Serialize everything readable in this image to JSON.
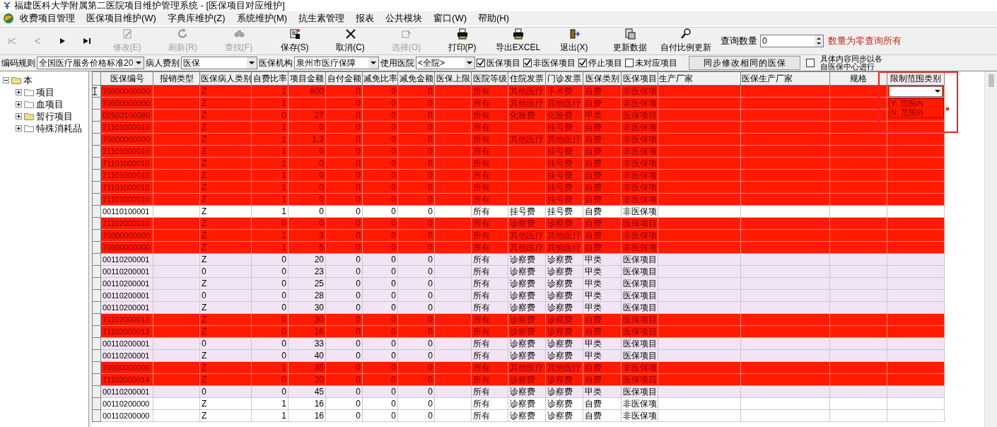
{
  "window": {
    "title": "福建医科大学附属第二医院项目维护管理系统 - [医保项目对应维护]"
  },
  "menu": [
    "收费项目管理",
    "医保项目维护(W)",
    "字典库维护(Z)",
    "系统维护(M)",
    "抗生素管理",
    "报表",
    "公共模块",
    "窗口(W)",
    "帮助(H)"
  ],
  "toolbar": {
    "buttons": [
      {
        "kind": "first",
        "disabled": true
      },
      {
        "kind": "prev",
        "disabled": true
      },
      {
        "kind": "next",
        "disabled": false
      },
      {
        "kind": "last",
        "disabled": false
      },
      {
        "kind": "edit",
        "label": "修改(E)",
        "disabled": true
      },
      {
        "kind": "refresh",
        "label": "刷新(R)",
        "disabled": true
      },
      {
        "kind": "find",
        "label": "查找(F)",
        "disabled": true
      },
      {
        "kind": "save",
        "label": "保存(S)",
        "disabled": false
      },
      {
        "kind": "cancel",
        "label": "取消(C)",
        "disabled": false
      },
      {
        "kind": "select",
        "label": "选择(O)",
        "disabled": true
      },
      {
        "kind": "print",
        "label": "打印(P)",
        "disabled": false
      },
      {
        "kind": "export",
        "label": "导出EXCEL",
        "disabled": false
      },
      {
        "kind": "exit",
        "label": "退出(X)",
        "disabled": false
      },
      {
        "kind": "update",
        "label": "更新数据",
        "disabled": false
      },
      {
        "kind": "ratio",
        "label": "自付比例更新",
        "disabled": false
      }
    ],
    "query_label": "查询数量",
    "query_value": "0",
    "query_hint": "数量为零查询所有"
  },
  "filters": {
    "selects": [
      {
        "label": "编码规则",
        "value": "全国医疗服务价格标准20"
      },
      {
        "label": "病人费别",
        "value": "医保"
      },
      {
        "label": "医保机构",
        "value": "泉州市医疗保障"
      },
      {
        "label": "使用医院",
        "value": "<全院>"
      }
    ],
    "checkboxes": [
      {
        "label": "医保项目",
        "checked": true
      },
      {
        "label": "非医保项目",
        "checked": true
      },
      {
        "label": "停止项目",
        "checked": true
      },
      {
        "label": "未对应项目",
        "checked": false
      }
    ],
    "sync_button": "同步修改相同的医保",
    "sync_checkbox": {
      "checked": false
    },
    "sync_note": [
      "具体内容同步以各",
      "自医保中心进行"
    ]
  },
  "tree": {
    "label": "本",
    "expanded": true,
    "children": [
      {
        "label": "项目",
        "expanded": false,
        "kind": "plain"
      },
      {
        "label": "血项目",
        "expanded": false,
        "kind": "plain"
      },
      {
        "label": "暂行项目",
        "expanded": false,
        "kind": "filled"
      },
      {
        "label": "特殊消耗品",
        "expanded": false,
        "kind": "plain"
      }
    ]
  },
  "table": {
    "columns": [
      "医保编号",
      "报销类型",
      "医保病人类别",
      "自费比率",
      "项目金额",
      "自付金额",
      "减免比率",
      "减免金额",
      "医保上限",
      "医院等级",
      "住院发票",
      "门诊发票",
      "医保类别",
      "医保项目",
      "生产厂家",
      "医保生产厂家",
      "规格",
      "限制范围类别"
    ],
    "dropdown": {
      "options": [
        "Y: 范围内",
        "N: 范围外"
      ]
    },
    "rows": [
      {
        "color": "#ff1a00",
        "current": true,
        "cells": [
          "70000000000",
          "",
          "Z",
          "1",
          "800",
          "0",
          "0",
          "0",
          "",
          "所有",
          "其他医疗",
          "手术费",
          "自费",
          "非医保项",
          "",
          "",
          "",
          ""
        ]
      },
      {
        "color": "#ff1a00",
        "current": false,
        "cells": [
          "70000000000",
          "",
          "Z",
          "1",
          "",
          "0",
          "0",
          "0",
          "",
          "所有",
          "其他医疗",
          "其他医疗",
          "自费",
          "非医保项",
          "",
          "",
          "",
          ""
        ]
      },
      {
        "color": "#ff1a00",
        "current": false,
        "cells": [
          "02503100080",
          "",
          "Z",
          "0",
          "27",
          "0",
          "0",
          "0",
          "",
          "所有",
          "化验费",
          "化验费",
          "甲类",
          "医保项目",
          "",
          "",
          "",
          ""
        ]
      },
      {
        "color": "#ff1a00",
        "current": false,
        "cells": [
          "71101000010",
          "",
          "Z",
          "1",
          "0",
          "0",
          "0",
          "0",
          "",
          "所有",
          "",
          "挂号费",
          "自费",
          "非医保项",
          "",
          "",
          "",
          ""
        ]
      },
      {
        "color": "#ff1a00",
        "current": false,
        "cells": [
          "70000000000",
          "",
          "Z",
          "1",
          "1.3",
          "0",
          "0",
          "0",
          "",
          "所有",
          "其他医疗",
          "其他医疗",
          "自费",
          "非医保项",
          "",
          "",
          "",
          ""
        ]
      },
      {
        "color": "#ff1a00",
        "current": false,
        "cells": [
          "71101000010",
          "",
          "Z",
          "1",
          "0",
          "0",
          "0",
          "0",
          "",
          "所有",
          "",
          "挂号费",
          "自费",
          "非医保项",
          "",
          "",
          "",
          ""
        ]
      },
      {
        "color": "#ff1a00",
        "current": false,
        "cells": [
          "71101000010",
          "",
          "Z",
          "1",
          "0",
          "0",
          "0",
          "0",
          "",
          "所有",
          "",
          "挂号费",
          "自费",
          "非医保项",
          "",
          "",
          "",
          ""
        ]
      },
      {
        "color": "#ff1a00",
        "current": false,
        "cells": [
          "71101000010",
          "",
          "Z",
          "1",
          "0",
          "0",
          "0",
          "0",
          "",
          "所有",
          "",
          "挂号费",
          "自费",
          "非医保项",
          "",
          "",
          "",
          ""
        ]
      },
      {
        "color": "#ff1a00",
        "current": false,
        "cells": [
          "71101000010",
          "",
          "Z",
          "1",
          "0",
          "0",
          "0",
          "0",
          "",
          "所有",
          "",
          "挂号费",
          "自费",
          "非医保项",
          "",
          "",
          "",
          ""
        ]
      },
      {
        "color": "#ff1a00",
        "current": false,
        "cells": [
          "71101000010",
          "",
          "Z",
          "1",
          "0",
          "0",
          "0",
          "0",
          "",
          "所有",
          "",
          "挂号费",
          "自费",
          "非医保项",
          "",
          "",
          "",
          ""
        ]
      },
      {
        "color": "#ffffff",
        "current": false,
        "cells": [
          "00110100001",
          "",
          "Z",
          "1",
          "0",
          "0",
          "0",
          "0",
          "",
          "所有",
          "挂号费",
          "挂号费",
          "自费",
          "非医保项",
          "",
          "",
          "",
          ""
        ]
      },
      {
        "color": "#ff1a00",
        "current": false,
        "cells": [
          "71102000010",
          "",
          "Z",
          "0",
          "0",
          "0",
          "0",
          "0",
          "",
          "所有",
          "诊察费",
          "诊察费",
          "自费",
          "医保项目",
          "",
          "",
          "",
          ""
        ]
      },
      {
        "color": "#ff1a00",
        "current": false,
        "cells": [
          "70000000000",
          "",
          "Z",
          "1",
          "3",
          "0",
          "0",
          "0",
          "",
          "所有",
          "其他医疗",
          "其他医疗",
          "自费",
          "非医保项",
          "",
          "",
          "",
          ""
        ]
      },
      {
        "color": "#ff1a00",
        "current": false,
        "cells": [
          "70000000000",
          "",
          "Z",
          "1",
          "5",
          "0",
          "0",
          "0",
          "",
          "所有",
          "其他医疗",
          "其他医疗",
          "自费",
          "非医保项",
          "",
          "",
          "",
          ""
        ]
      },
      {
        "color": "#f1e5f5",
        "current": false,
        "cells": [
          "00110200001",
          "",
          "Z",
          "0",
          "20",
          "0",
          "0",
          "0",
          "",
          "所有",
          "诊察费",
          "诊察费",
          "甲类",
          "医保项目",
          "",
          "",
          "",
          ""
        ]
      },
      {
        "color": "#f1e5f5",
        "current": false,
        "cells": [
          "00110200001",
          "",
          "0",
          "0",
          "23",
          "0",
          "0",
          "0",
          "",
          "所有",
          "诊察费",
          "诊察费",
          "甲类",
          "医保项目",
          "",
          "",
          "",
          ""
        ]
      },
      {
        "color": "#f1e5f5",
        "current": false,
        "cells": [
          "00110200001",
          "",
          "Z",
          "0",
          "25",
          "0",
          "0",
          "0",
          "",
          "所有",
          "诊察费",
          "诊察费",
          "甲类",
          "医保项目",
          "",
          "",
          "",
          ""
        ]
      },
      {
        "color": "#f1e5f5",
        "current": false,
        "cells": [
          "00110200001",
          "",
          "0",
          "0",
          "28",
          "0",
          "0",
          "0",
          "",
          "所有",
          "诊察费",
          "诊察费",
          "甲类",
          "医保项目",
          "",
          "",
          "",
          ""
        ]
      },
      {
        "color": "#f1e5f5",
        "current": false,
        "cells": [
          "00110200001",
          "",
          "Z",
          "0",
          "30",
          "0",
          "0",
          "0",
          "",
          "所有",
          "诊察费",
          "诊察费",
          "甲类",
          "医保项目",
          "",
          "",
          "",
          ""
        ]
      },
      {
        "color": "#ff1a00",
        "current": false,
        "cells": [
          "71102000013",
          "",
          "Z",
          "0",
          "30",
          "0",
          "0",
          "0",
          "",
          "所有",
          "诊察费",
          "诊察费",
          "自费",
          "医保项目",
          "",
          "",
          "",
          ""
        ]
      },
      {
        "color": "#ff1a00",
        "current": false,
        "cells": [
          "71102000013",
          "",
          "Z",
          "0",
          "16",
          "0",
          "0",
          "0",
          "",
          "所有",
          "诊察费",
          "诊察费",
          "自费",
          "医保项目",
          "",
          "",
          "",
          ""
        ]
      },
      {
        "color": "#f1e5f5",
        "current": false,
        "cells": [
          "00110200001",
          "",
          "0",
          "0",
          "33",
          "0",
          "0",
          "0",
          "",
          "所有",
          "诊察费",
          "诊察费",
          "甲类",
          "医保项目",
          "",
          "",
          "",
          ""
        ]
      },
      {
        "color": "#f1e5f5",
        "current": false,
        "cells": [
          "00110200001",
          "",
          "Z",
          "0",
          "40",
          "0",
          "0",
          "0",
          "",
          "所有",
          "诊察费",
          "诊察费",
          "甲类",
          "医保项目",
          "",
          "",
          "",
          ""
        ]
      },
      {
        "color": "#ff1a00",
        "current": false,
        "cells": [
          "70000000000",
          "",
          "Z",
          "1",
          "35",
          "0",
          "0",
          "0",
          "",
          "所有",
          "其他医疗",
          "其他医疗",
          "自费",
          "非医保项",
          "",
          "",
          "",
          ""
        ]
      },
      {
        "color": "#ff1a00",
        "current": false,
        "cells": [
          "71102000014",
          "",
          "Z",
          "0",
          "20",
          "0",
          "0",
          "0",
          "",
          "所有",
          "诊察费",
          "诊察费",
          "自费",
          "医保项目",
          "",
          "",
          "",
          ""
        ]
      },
      {
        "color": "#f1e5f5",
        "current": false,
        "cells": [
          "00110200001",
          "",
          "0",
          "0",
          "45",
          "0",
          "0",
          "0",
          "",
          "所有",
          "诊察费",
          "诊察费",
          "甲类",
          "医保项目",
          "",
          "",
          "",
          ""
        ]
      },
      {
        "color": "#ffffff",
        "current": false,
        "cells": [
          "00110200000",
          "",
          "Z",
          "1",
          "16",
          "0",
          "0",
          "0",
          "",
          "所有",
          "诊察费",
          "诊察费",
          "自费",
          "非医保项",
          "",
          "",
          "",
          ""
        ]
      },
      {
        "color": "#ffffff",
        "current": false,
        "cells": [
          "00110200000",
          "",
          "Z",
          "1",
          "16",
          "0",
          "0",
          "0",
          "",
          "所有",
          "诊察费",
          "诊察费",
          "自费",
          "非医保项",
          "",
          "",
          "",
          ""
        ]
      }
    ]
  }
}
